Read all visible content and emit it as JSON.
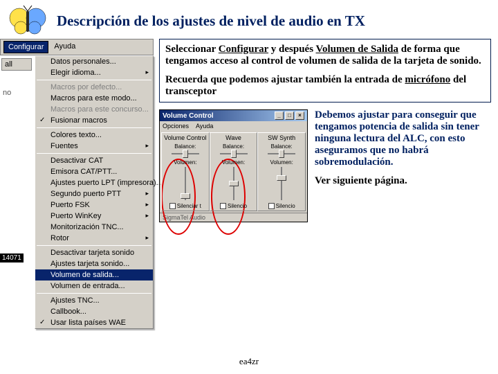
{
  "header": {
    "title": "Descripción de los ajustes de nivel de audio en TX"
  },
  "menubar": {
    "active": "Configurar",
    "other": "Ayuda"
  },
  "sidelabels": {
    "all": "all",
    "no": "no",
    "freq": "14071"
  },
  "dropdown": {
    "items": [
      {
        "label": "Datos personales...",
        "type": "normal"
      },
      {
        "label": "Elegir idioma...",
        "type": "arrow"
      },
      {
        "sep": true
      },
      {
        "label": "Macros por defecto...",
        "type": "disabled"
      },
      {
        "label": "Macros para este modo...",
        "type": "normal"
      },
      {
        "label": "Macros para este concurso...",
        "type": "disabled"
      },
      {
        "label": "Fusionar macros",
        "type": "check"
      },
      {
        "sep": true
      },
      {
        "label": "Colores texto...",
        "type": "normal"
      },
      {
        "label": "Fuentes",
        "type": "arrow"
      },
      {
        "sep": true
      },
      {
        "label": "Desactivar CAT",
        "type": "normal"
      },
      {
        "label": "Emisora CAT/PTT...",
        "type": "normal"
      },
      {
        "label": "Ajustes puerto LPT (impresora)...",
        "type": "normal"
      },
      {
        "label": "Segundo puerto PTT",
        "type": "arrow"
      },
      {
        "label": "Puerto FSK",
        "type": "arrow"
      },
      {
        "label": "Puerto WinKey",
        "type": "arrow"
      },
      {
        "label": "Monitorización TNC...",
        "type": "normal"
      },
      {
        "label": "Rotor",
        "type": "arrow"
      },
      {
        "sep": true
      },
      {
        "label": "Desactivar tarjeta sonido",
        "type": "normal"
      },
      {
        "label": "Ajustes tarjeta sonido...",
        "type": "normal"
      },
      {
        "label": "Volumen de salida...",
        "type": "sel"
      },
      {
        "label": "Volumen de entrada...",
        "type": "normal"
      },
      {
        "sep": true
      },
      {
        "label": "Ajustes TNC...",
        "type": "normal"
      },
      {
        "label": "Callbook...",
        "type": "normal"
      },
      {
        "label": "Usar lista países WAE",
        "type": "check"
      }
    ]
  },
  "box1": {
    "p1a": "Seleccionar ",
    "p1b": "Configurar",
    "p1c": " y después ",
    "p1d": "Volumen de Salida",
    "p1e": " de forma que tengamos acceso al control de volumen de salida de la tarjeta de sonido.",
    "p2a": "Recuerda que podemos ajustar también la entrada de ",
    "p2b": "micrófono",
    "p2c": " del transceptor"
  },
  "volctl": {
    "title": "Volume Control",
    "menu1": "Opciones",
    "menu2": "Ayuda",
    "cols": [
      {
        "name": "Volume Control",
        "bal": "Balance:",
        "vol": "Volumen:",
        "mute": "Silenciar t",
        "thumb": 38
      },
      {
        "name": "Wave",
        "bal": "Balance:",
        "vol": "Volumen:",
        "mute": "Silencio",
        "thumb": 20
      },
      {
        "name": "SW Synth",
        "bal": "Balance:",
        "vol": "Volumen:",
        "mute": "Silencio",
        "thumb": 12
      }
    ],
    "status": "SigmaTel Audio"
  },
  "right": {
    "p1": "Debemos ajustar para conseguir que tengamos potencia de salida sin tener ninguna lectura del ALC, con esto aseguramos que no habrá sobremodulación.",
    "p2": "Ver siguiente página."
  },
  "footer": "ea4zr"
}
